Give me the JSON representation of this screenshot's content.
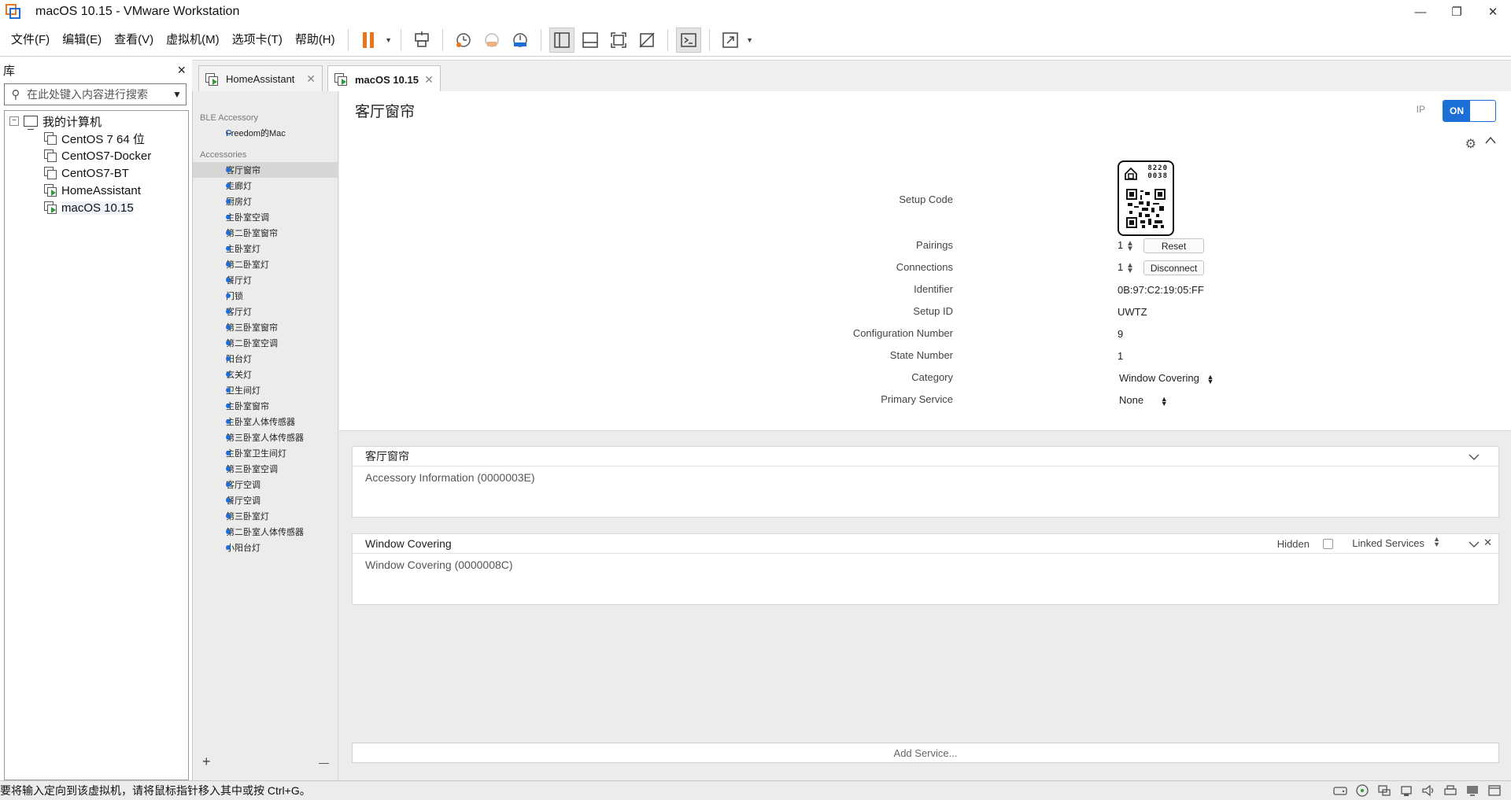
{
  "window": {
    "title": "macOS 10.15 - VMware Workstation",
    "minimize": "—",
    "restore": "❐",
    "close": "✕"
  },
  "menu": [
    "文件(F)",
    "编辑(E)",
    "查看(V)",
    "虚拟机(M)",
    "选项卡(T)",
    "帮助(H)"
  ],
  "library": {
    "title": "库",
    "close": "×",
    "search_placeholder": "在此处键入内容进行搜索",
    "root": "我的计算机",
    "vms": [
      {
        "name": "CentOS 7 64 位",
        "running": false
      },
      {
        "name": "CentOS7-Docker",
        "running": false
      },
      {
        "name": "CentOS7-BT",
        "running": false
      },
      {
        "name": "HomeAssistant",
        "running": true
      },
      {
        "name": "macOS 10.15",
        "running": true
      }
    ]
  },
  "tabs": [
    {
      "label": "HomeAssistant",
      "active": false
    },
    {
      "label": "macOS 10.15",
      "active": true
    }
  ],
  "guest": {
    "sidebar": {
      "ble_header": "BLE Accessory",
      "ble_items": [
        "Freedom的Mac"
      ],
      "acc_header": "Accessories",
      "accessories": [
        "客厅窗帘",
        "走廊灯",
        "厨房灯",
        "主卧室空调",
        "第二卧室窗帘",
        "主卧室灯",
        "第二卧室灯",
        "餐厅灯",
        "门锁",
        "客厅灯",
        "第三卧室窗帘",
        "第二卧室空调",
        "阳台灯",
        "玄关灯",
        "卫生间灯",
        "主卧室窗帘",
        "主卧室人体传感器",
        "第三卧室人体传感器",
        "主卧室卫生间灯",
        "第三卧室空调",
        "客厅空调",
        "餐厅空调",
        "第三卧室灯",
        "第二卧室人体传感器",
        "小阳台灯"
      ],
      "selected_index": 0,
      "add": "+",
      "remove": "—"
    },
    "detail": {
      "title": "客厅窗帘",
      "ip_label": "IP",
      "toggle_on": "ON",
      "setup_code_label": "Setup Code",
      "setup_code": [
        "8220",
        "0038"
      ],
      "pairings_label": "Pairings",
      "pairings": "1",
      "reset": "Reset",
      "connections_label": "Connections",
      "connections": "1",
      "disconnect": "Disconnect",
      "identifier_label": "Identifier",
      "identifier": "0B:97:C2:19:05:FF",
      "setup_id_label": "Setup ID",
      "setup_id": "UWTZ",
      "config_label": "Configuration Number",
      "config": "9",
      "state_label": "State Number",
      "state": "1",
      "category_label": "Category",
      "category": "Window Covering",
      "primary_label": "Primary Service",
      "primary": "None"
    },
    "panels": [
      {
        "title": "客厅窗帘",
        "body": "Accessory Information (0000003E)"
      },
      {
        "title": "Window Covering",
        "body": "Window Covering (0000008C)",
        "hidden_label": "Hidden",
        "linked_label": "Linked Services"
      }
    ],
    "add_service": "Add Service..."
  },
  "status": {
    "message": "要将输入定向到该虚拟机，请将鼠标指针移入其中或按 Ctrl+G。"
  },
  "colors": {
    "accent": "#1d6fd8",
    "pause": "#e8761e"
  }
}
